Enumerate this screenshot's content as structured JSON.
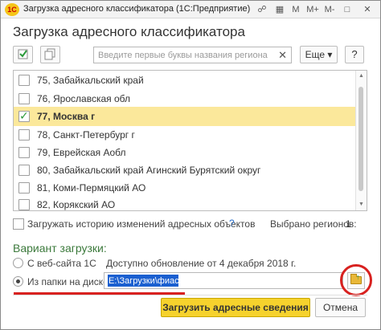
{
  "window": {
    "title": "Загрузка адресного классификатора (1С:Предприятие)",
    "logo_text": "1C",
    "buttons": [
      "M",
      "M+",
      "M-",
      "□",
      "✕"
    ]
  },
  "form": {
    "title": "Загрузка адресного классификатора"
  },
  "toolbar": {
    "search_placeholder": "Введите первые буквы названия региона",
    "search_value": "",
    "clear_icon": "✕",
    "more_label": "Еще ▾",
    "help_label": "?"
  },
  "regions": [
    {
      "label": "75, Забайкальский край",
      "checked": false,
      "selected": false
    },
    {
      "label": "76, Ярославская обл",
      "checked": false,
      "selected": false
    },
    {
      "label": "77, Москва г",
      "checked": true,
      "selected": true
    },
    {
      "label": "78, Санкт-Петербург г",
      "checked": false,
      "selected": false
    },
    {
      "label": "79, Еврейская Аобл",
      "checked": false,
      "selected": false
    },
    {
      "label": "80, Забайкальский край Агинский Бурятский округ",
      "checked": false,
      "selected": false
    },
    {
      "label": "81, Коми-Пермяцкий АО",
      "checked": false,
      "selected": false
    },
    {
      "label": "82, Корякский АО",
      "checked": false,
      "selected": false
    }
  ],
  "options": {
    "history_label": "Загружать историю изменений адресных объектов",
    "history_help": "?",
    "selected_label": "Выбрано регионов:",
    "selected_count": "1"
  },
  "variant": {
    "title": "Вариант загрузки:",
    "web_label": "С веб-сайта 1С",
    "update_note": "Доступно обновление от 4 декабря 2018 г.",
    "disk_label": "Из папки на диске:",
    "disk_path": "E:\\Загрузки\\фиас",
    "web_selected": false,
    "disk_selected": true
  },
  "footer": {
    "load_label": "Загрузить адресные сведения",
    "cancel_label": "Отмена"
  },
  "colors": {
    "accent_yellow": "#f6d22d",
    "selection_row": "#fbe89b",
    "annotation_red": "#d8211f",
    "section_green": "#3c7a3c"
  }
}
